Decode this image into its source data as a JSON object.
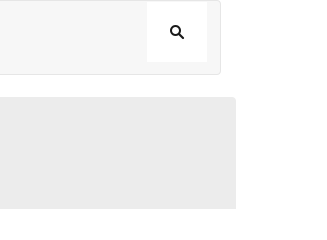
{
  "search": {
    "value": "",
    "placeholder": "",
    "button_icon": "search-icon"
  },
  "panel": {
    "text": ""
  },
  "colors": {
    "search_bar_bg": "#f7f7f7",
    "search_bar_border": "#e6e6e6",
    "search_button_bg": "#ffffff",
    "panel_bg": "#ececec",
    "icon_color": "#1a1a1a"
  }
}
